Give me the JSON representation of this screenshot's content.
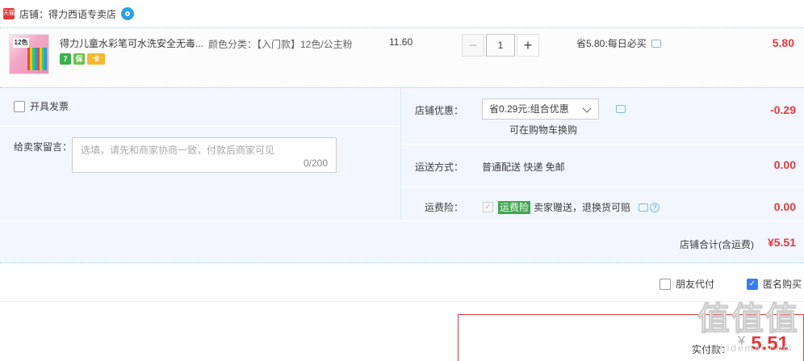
{
  "shop": {
    "badge": "天猫",
    "prefix": "店铺：",
    "name": "得力西语专卖店"
  },
  "item": {
    "thumb_label": "12色",
    "title": "得力儿童水彩笔可水洗安全无毒...",
    "service_icons": [
      "7",
      "保",
      "卡"
    ],
    "sku": "颜色分类：【入门款】12色/公主粉",
    "unit_price": "11.60",
    "quantity": "1",
    "qty_minus": "−",
    "qty_plus": "+",
    "promo": "省5.80:每日必买",
    "total": "5.80"
  },
  "invoice": {
    "label": "开具发票"
  },
  "message": {
    "label": "给卖家留言：",
    "placeholder": "选填，请先和商家协商一致，付款后商家可见",
    "count": "0/200"
  },
  "shop_discount": {
    "label": "店铺优惠：",
    "selected": "省0.29元:组合优惠",
    "note": "可在购物车换购",
    "amount": "-0.29"
  },
  "shipping": {
    "label": "运送方式：",
    "value": "普通配送 快递 免邮",
    "amount": "0.00"
  },
  "insurance": {
    "label": "运费险：",
    "tag": "运费险",
    "text": "卖家赠送，退换货可赔",
    "amount": "0.00"
  },
  "shop_total": {
    "label": "店铺合计(含运费)",
    "amount": "¥5.51"
  },
  "pay_options": {
    "friend_pay": "朋友代付",
    "anonymous": "匿名购买"
  },
  "payment": {
    "label": "实付款：",
    "currency": "¥",
    "amount": "5.51"
  },
  "watermark": {
    "text": "值值值",
    "sub": "zhidemai.com"
  },
  "colors": {
    "price_red": "#e4393c",
    "panel_bg": "#f2f7ff",
    "accent_blue": "#3b7cf0"
  }
}
